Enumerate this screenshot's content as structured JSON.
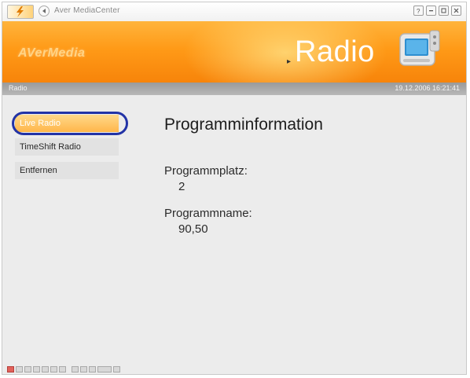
{
  "window": {
    "title": "Aver MediaCenter"
  },
  "titlebar": {
    "logo_icon": "avermedia-lightning-logo",
    "back_icon": "back-arrow-icon",
    "controls": [
      "help-icon",
      "minimize-icon",
      "restore-icon",
      "close-icon"
    ]
  },
  "banner": {
    "brand": "AVerMedia",
    "section_title": "Radio",
    "arrow": "▸",
    "device_icon": "radio-device-icon",
    "colors": {
      "orange_top": "#ffb43c",
      "orange_bottom": "#f7840a"
    }
  },
  "statusbar": {
    "section": "Radio",
    "datetime": "19.12.2006 16:21:41"
  },
  "menu": {
    "items": [
      {
        "label": "Live Radio",
        "active": true
      },
      {
        "label": "TimeShift Radio",
        "active": false
      },
      {
        "label": "Entfernen",
        "active": false
      }
    ],
    "highlight_color": "#2233a6"
  },
  "content": {
    "heading": "Programminformation",
    "fields": [
      {
        "label": "Programmplatz:",
        "value": "2"
      },
      {
        "label": "Programmname:",
        "value": "90,50"
      }
    ]
  }
}
